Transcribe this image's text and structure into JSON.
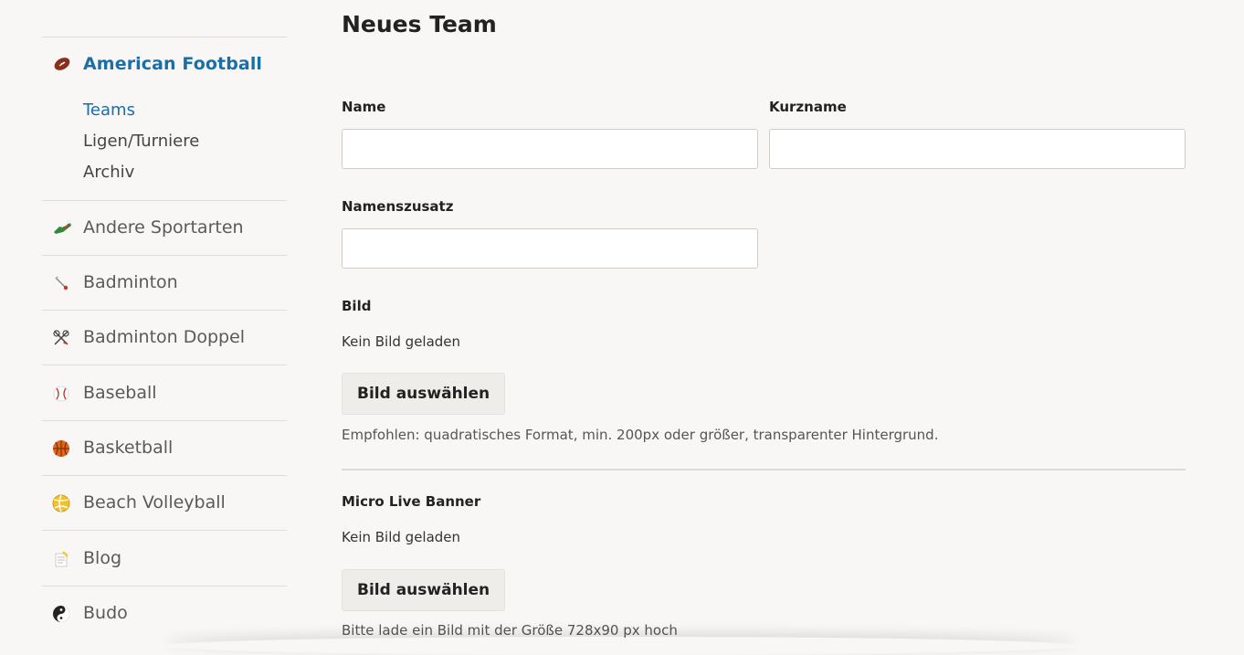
{
  "sidebar": {
    "active_sport": {
      "label": "American Football",
      "icon": "football-icon",
      "subnav": [
        {
          "label": "Teams",
          "active": true
        },
        {
          "label": "Ligen/Turniere",
          "active": false
        },
        {
          "label": "Archiv",
          "active": false
        }
      ]
    },
    "sports": [
      {
        "label": "Andere Sportarten",
        "icon": "sneaker-icon"
      },
      {
        "label": "Badminton",
        "icon": "shuttlecock-icon"
      },
      {
        "label": "Badminton Doppel",
        "icon": "crossed-rackets-icon"
      },
      {
        "label": "Baseball",
        "icon": "baseball-icon"
      },
      {
        "label": "Basketball",
        "icon": "basketball-icon"
      },
      {
        "label": "Beach Volleyball",
        "icon": "volleyball-icon"
      },
      {
        "label": "Blog",
        "icon": "notepad-icon"
      },
      {
        "label": "Budo",
        "icon": "yin-yang-icon"
      }
    ]
  },
  "main": {
    "title": "Neues Team",
    "fields": {
      "name": {
        "label": "Name",
        "value": ""
      },
      "shortname": {
        "label": "Kurzname",
        "value": ""
      },
      "suffix": {
        "label": "Namenszusatz",
        "value": ""
      }
    },
    "image": {
      "label": "Bild",
      "status": "Kein Bild geladen",
      "button": "Bild auswählen",
      "hint": "Empfohlen: quadratisches Format, min. 200px oder größer, transparenter Hintergrund."
    },
    "banner": {
      "label": "Micro Live Banner",
      "status": "Kein Bild geladen",
      "button": "Bild auswählen",
      "hint": "Bitte lade ein Bild mit der Größe 728x90 px hoch"
    }
  },
  "colors": {
    "accent": "#1a6fa7",
    "background": "#f8f7f5"
  }
}
